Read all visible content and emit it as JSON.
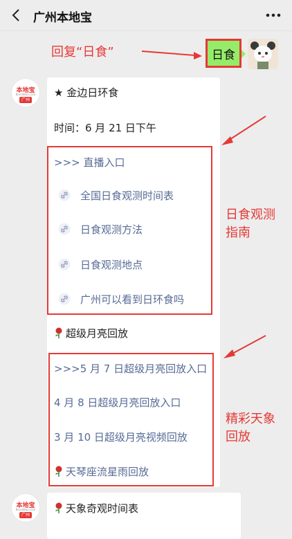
{
  "header": {
    "title": "广州本地宝"
  },
  "user_message": {
    "text": "日食"
  },
  "annotations": {
    "reply_hint": "回复“日食”",
    "guide_label_1": "日食观测",
    "guide_label_2": "指南",
    "replay_label_1": "精彩天象",
    "replay_label_2": "回放"
  },
  "account_avatar": {
    "brand": "本地宝",
    "site": "BendiBao.com",
    "city": "广州"
  },
  "card": {
    "heading": "★ 金边日环食",
    "time": "时间：6 月 21 日下午",
    "live_entry": ">>> 直播入口",
    "eclipse_links": [
      "全国日食观测时间表",
      "日食观测方法",
      "日食观测地点",
      "广州可以看到日环食吗"
    ],
    "supermoon_heading": "超级月亮回放",
    "replay_links": [
      ">>>5 月 7 日超级月亮回放入口",
      "4 月 8 日超级月亮回放入口",
      "3 月 10 日超级月亮视频回放",
      "天琴座流星雨回放"
    ]
  },
  "card2": {
    "heading": "天象奇观时间表"
  },
  "colors": {
    "accent_red": "#e53935",
    "link_blue": "#576b95",
    "bubble_green": "#95ec69"
  },
  "icons": [
    "back-icon",
    "more-icon",
    "link-icon",
    "rose-icon"
  ]
}
